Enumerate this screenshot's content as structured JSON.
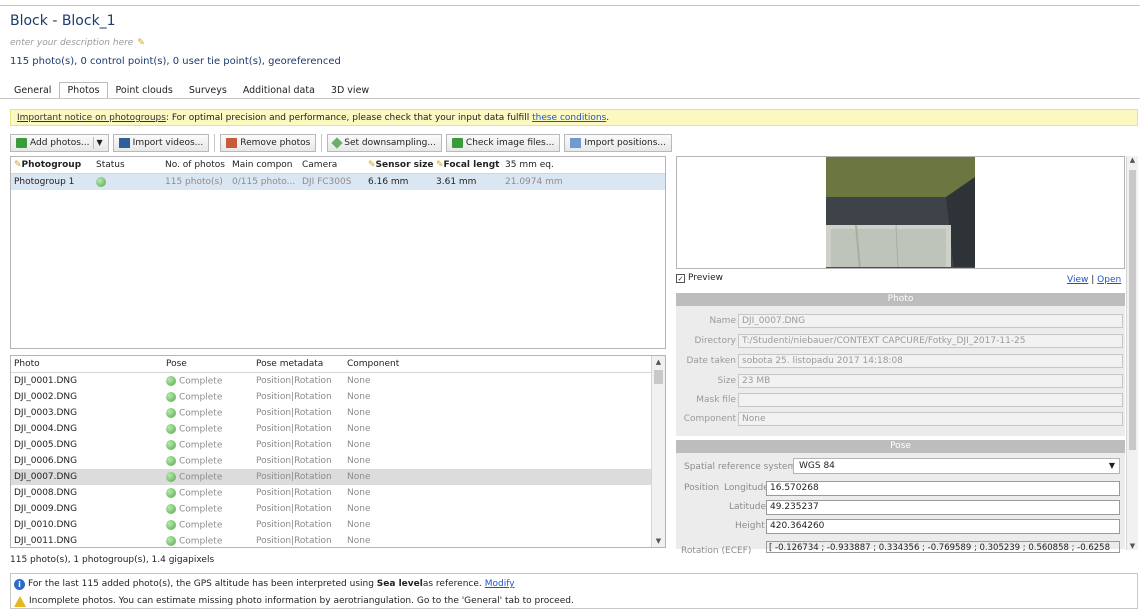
{
  "header": {
    "title": "Block - Block_1",
    "description_placeholder": "enter your description here",
    "summary": "115 photo(s), 0 control point(s), 0 user tie point(s), georeferenced"
  },
  "tabs": [
    "General",
    "Photos",
    "Point clouds",
    "Surveys",
    "Additional data",
    "3D view"
  ],
  "notice": {
    "label": "Important notice on photogroups",
    "text": ": For optimal precision and performance, please check that your input data fulfill ",
    "link": "these conditions",
    "end": "."
  },
  "toolbar": {
    "add_photos": "Add photos...",
    "import_videos": "Import videos...",
    "remove_photos": "Remove photos",
    "set_downsampling": "Set downsampling...",
    "check_image_files": "Check image files...",
    "import_positions": "Import positions..."
  },
  "photogroups": {
    "columns": [
      "Photogroup",
      "Status",
      "No. of photos",
      "Main compon",
      "Camera",
      "Sensor size",
      "Focal lengt",
      "35 mm eq."
    ],
    "rows": [
      {
        "name": "Photogroup 1",
        "photos": "115 photo(s)",
        "component": "0/115 photo...",
        "camera": "DJI FC300S",
        "sensor": "6.16 mm",
        "focal": "3.61 mm",
        "eq35": "21.0974 mm"
      }
    ]
  },
  "photos": {
    "columns": [
      "Photo",
      "Pose",
      "Pose metadata",
      "Component"
    ],
    "rows": [
      {
        "photo": "DJI_0001.DNG",
        "pose": "Complete",
        "metadata": "Position|Rotation",
        "component": "None"
      },
      {
        "photo": "DJI_0002.DNG",
        "pose": "Complete",
        "metadata": "Position|Rotation",
        "component": "None"
      },
      {
        "photo": "DJI_0003.DNG",
        "pose": "Complete",
        "metadata": "Position|Rotation",
        "component": "None"
      },
      {
        "photo": "DJI_0004.DNG",
        "pose": "Complete",
        "metadata": "Position|Rotation",
        "component": "None"
      },
      {
        "photo": "DJI_0005.DNG",
        "pose": "Complete",
        "metadata": "Position|Rotation",
        "component": "None"
      },
      {
        "photo": "DJI_0006.DNG",
        "pose": "Complete",
        "metadata": "Position|Rotation",
        "component": "None"
      },
      {
        "photo": "DJI_0007.DNG",
        "pose": "Complete",
        "metadata": "Position|Rotation",
        "component": "None"
      },
      {
        "photo": "DJI_0008.DNG",
        "pose": "Complete",
        "metadata": "Position|Rotation",
        "component": "None"
      },
      {
        "photo": "DJI_0009.DNG",
        "pose": "Complete",
        "metadata": "Position|Rotation",
        "component": "None"
      },
      {
        "photo": "DJI_0010.DNG",
        "pose": "Complete",
        "metadata": "Position|Rotation",
        "component": "None"
      },
      {
        "photo": "DJI_0011.DNG",
        "pose": "Complete",
        "metadata": "Position|Rotation",
        "component": "None"
      }
    ]
  },
  "stats": "115 photo(s), 1 photogroup(s), 1.4 gigapixels",
  "messages": {
    "info_pre": "For the last 115 added photo(s), the GPS altitude has been interpreted using ",
    "info_bold": "Sea level",
    "info_post": " as reference.",
    "info_link": "Modify",
    "warning": "Incomplete photos. You can estimate missing photo information by aerotriangulation. Go to the 'General' tab to proceed."
  },
  "preview": {
    "label": "Preview",
    "view_link": "View",
    "separator": "|",
    "open_link": "Open"
  },
  "photo_section": {
    "header": "Photo",
    "name_label": "Name",
    "name": "DJI_0007.DNG",
    "directory_label": "Directory",
    "directory": "T:/Studenti/niebauer/CONTEXT CAPCURE/Fotky_DJI_2017-11-25",
    "date_label": "Date taken",
    "date": "sobota 25. listopadu 2017 14:18:08",
    "size_label": "Size",
    "size": "23 MB",
    "mask_label": "Mask file",
    "mask": "",
    "component_label": "Component",
    "component": "None"
  },
  "pose_section": {
    "header": "Pose",
    "srs_label": "Spatial reference system:",
    "srs_value": "WGS 84",
    "position_label": "Position",
    "longitude_label": "Longitude",
    "longitude": "16.570268",
    "latitude_label": "Latitude",
    "latitude": "49.235237",
    "height_label": "Height",
    "height": "420.364260",
    "rotation_label": "Rotation (ECEF)",
    "rotation": "[ -0.126734 ; -0.933887 ; 0.334356 ; -0.769589 ; 0.305239 ; 0.560858 ; -0.6258"
  },
  "colors": {
    "title": "#1a3c6e",
    "link": "#1a56c8",
    "notice_bg": "#fbf8c2",
    "selected_row": "#dbe6f3",
    "ok_green": "#52a84a"
  }
}
